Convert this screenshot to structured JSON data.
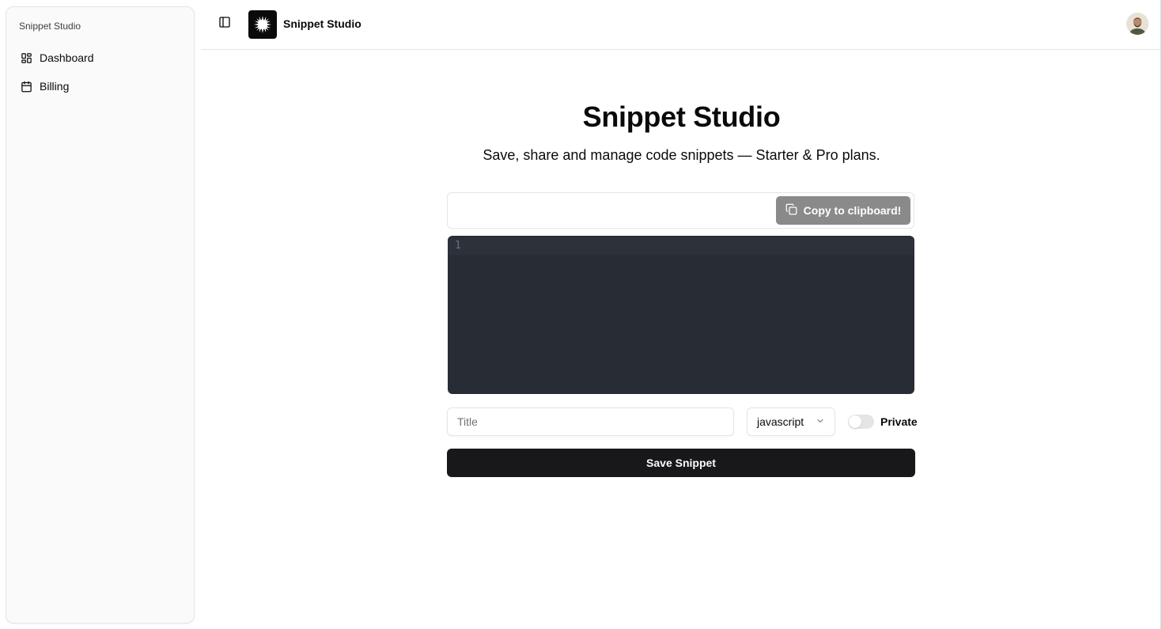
{
  "sidebar": {
    "group_label": "Snippet Studio",
    "items": [
      {
        "label": "Dashboard",
        "icon": "layout-dashboard-icon"
      },
      {
        "label": "Billing",
        "icon": "calendar-icon"
      }
    ]
  },
  "topbar": {
    "toggle_icon": "panel-left-icon",
    "brand": "Snippet Studio",
    "logo_icon": "starburst-logo-icon",
    "avatar_icon": "user-avatar"
  },
  "main": {
    "title": "Snippet Studio",
    "subtitle": "Save, share and manage code snippets — Starter & Pro plans.",
    "copy_button_label": "Copy to clipboard!",
    "editor": {
      "line_numbers": [
        "1"
      ],
      "content": ""
    },
    "title_input": {
      "placeholder": "Title",
      "value": ""
    },
    "language_select": {
      "value": "javascript"
    },
    "private_toggle": {
      "label": "Private",
      "checked": false
    },
    "save_button_label": "Save Snippet"
  },
  "colors": {
    "editor_bg": "#282c34",
    "primary_button": "#18181b",
    "copy_button": "#8a8a8a"
  }
}
